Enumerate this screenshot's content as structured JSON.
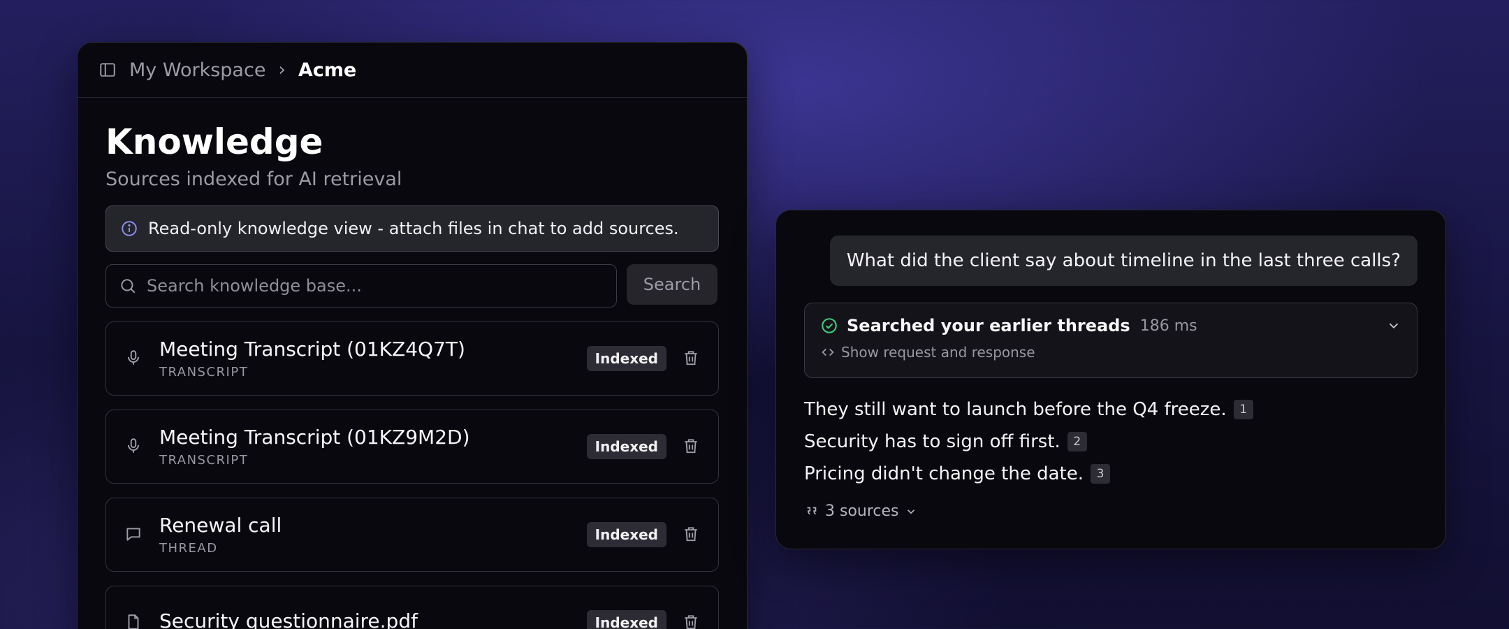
{
  "breadcrumb": {
    "workspace": "My Workspace",
    "separator": "›",
    "current": "Acme"
  },
  "page": {
    "title": "Knowledge",
    "subtitle": "Sources indexed for AI retrieval"
  },
  "notice": {
    "text": "Read-only knowledge view - attach files in chat to add sources."
  },
  "search": {
    "placeholder": "Search knowledge base...",
    "value": "",
    "button_label": "Search"
  },
  "sources": [
    {
      "icon": "microphone-icon",
      "title": "Meeting Transcript (01KZ4Q7T)",
      "type": "TRANSCRIPT",
      "status": "Indexed"
    },
    {
      "icon": "microphone-icon",
      "title": "Meeting Transcript (01KZ9M2D)",
      "type": "TRANSCRIPT",
      "status": "Indexed"
    },
    {
      "icon": "message-icon",
      "title": "Renewal call",
      "type": "THREAD",
      "status": "Indexed"
    },
    {
      "icon": "file-icon",
      "title": "Security questionnaire.pdf",
      "type": "",
      "status": "Indexed"
    }
  ],
  "chat": {
    "user_message": "What did the client say about timeline in the last three calls?",
    "tool_call": {
      "title": "Searched your earlier threads",
      "duration": "186 ms",
      "link_label": "Show request and response"
    },
    "answer_lines": [
      {
        "text": "They still want to launch before the Q4 freeze.",
        "citation": "1"
      },
      {
        "text": "Security has to sign off first.",
        "citation": "2"
      },
      {
        "text": "Pricing didn't change the date.",
        "citation": "3"
      }
    ],
    "sources_label": "3 sources"
  },
  "colors": {
    "background": "#1a1747",
    "panel": "#09080f",
    "success": "#3fcf7a",
    "info": "#8b8ff0"
  }
}
